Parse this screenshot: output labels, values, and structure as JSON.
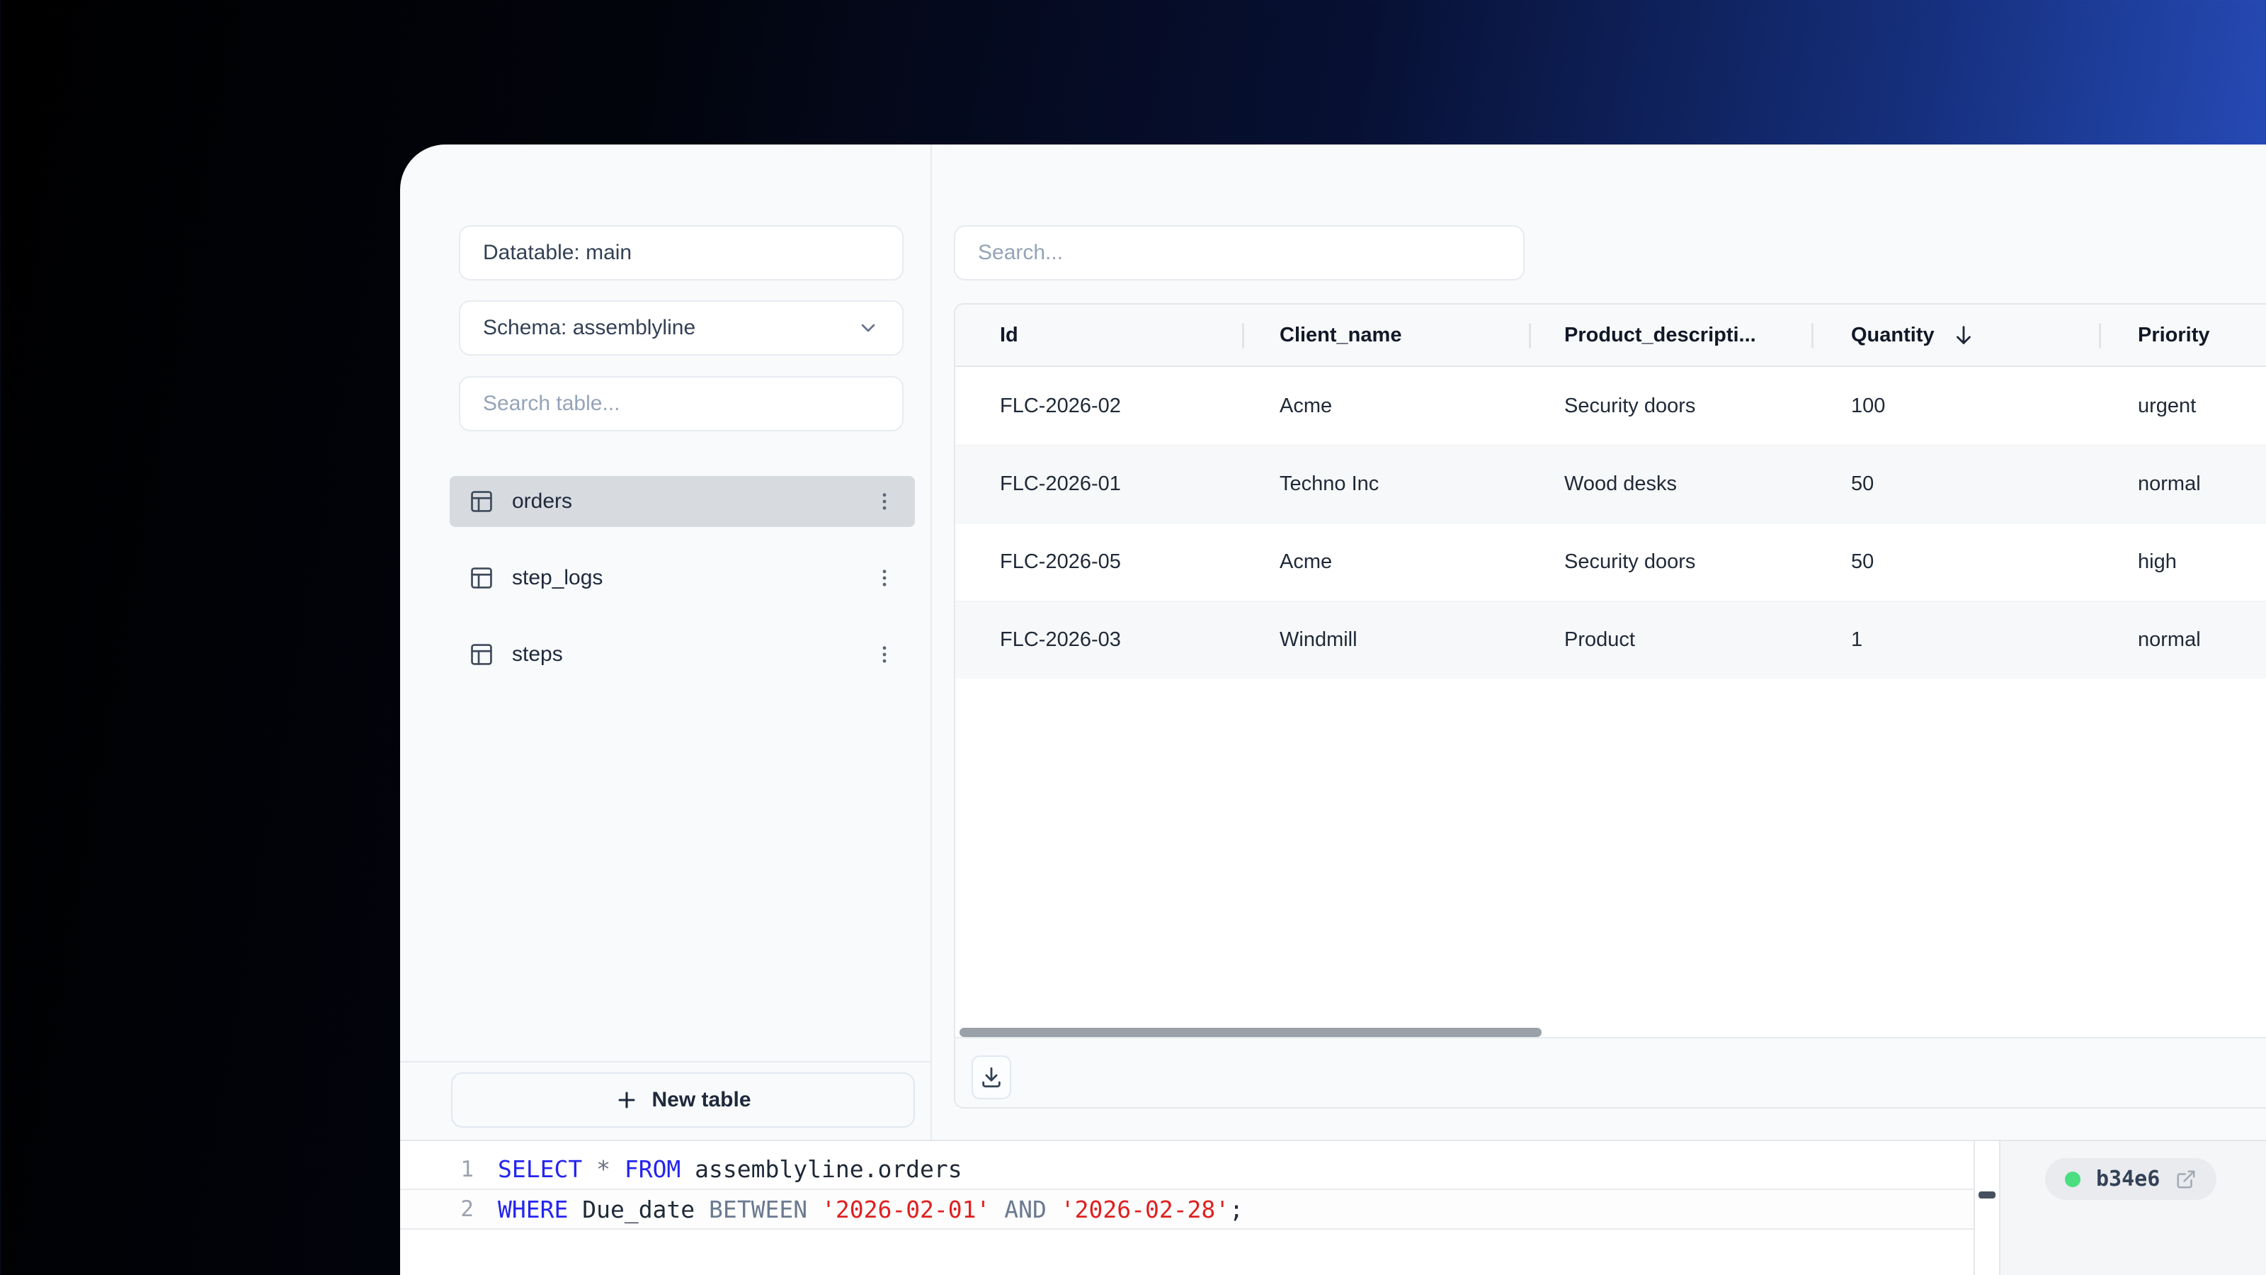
{
  "colors": {
    "background_left": "#000000",
    "background_right": "#2e5ad4",
    "panel_bg": "#f8fafc",
    "selected_item_bg": "#d7dbdf",
    "status_dot_green": "#4ade80",
    "sql_keyword_blue": "#2424f0",
    "sql_secondary_slate": "#6b7a90",
    "sql_string_red": "#e01f1f",
    "scrollbar_gray": "#9aa1a8"
  },
  "sidebar": {
    "datatable_label": "Datatable: main",
    "schema_label": "Schema: assemblyline",
    "table_search_placeholder": "Search table...",
    "tables": [
      {
        "name": "orders",
        "selected": true
      },
      {
        "name": "step_logs",
        "selected": false
      },
      {
        "name": "steps",
        "selected": false
      }
    ],
    "new_table_label": "New table"
  },
  "main": {
    "search_placeholder": "Search...",
    "table": {
      "columns": [
        "Id",
        "Client_name",
        "Product_descripti...",
        "Quantity",
        "Priority"
      ],
      "sort": {
        "column": "Quantity",
        "direction": "desc"
      },
      "rows": [
        [
          "FLC-2026-02",
          "Acme",
          "Security doors",
          "100",
          "urgent"
        ],
        [
          "FLC-2026-01",
          "Techno Inc",
          "Wood desks",
          "50",
          "normal"
        ],
        [
          "FLC-2026-05",
          "Acme",
          "Security doors",
          "50",
          "high"
        ],
        [
          "FLC-2026-03",
          "Windmill",
          "Product",
          "1",
          "normal"
        ]
      ]
    }
  },
  "editor": {
    "lines": [
      {
        "number": "1",
        "tokens": [
          "SELECT ",
          "* ",
          "FROM ",
          "assemblyline.orders"
        ]
      },
      {
        "number": "2",
        "tokens": [
          "WHERE ",
          "Due_date ",
          "BETWEEN ",
          "'2026-02-01'",
          " AND ",
          "'2026-02-28'",
          ";"
        ]
      }
    ],
    "status_badge": "b34e6"
  }
}
